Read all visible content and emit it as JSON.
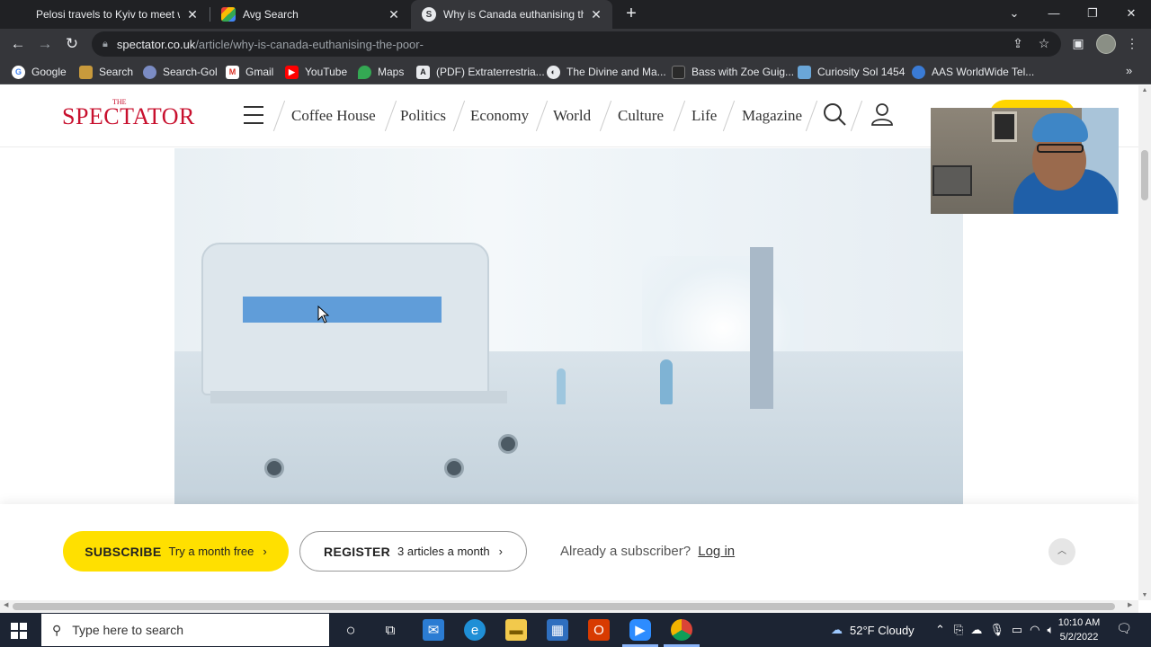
{
  "browser": {
    "tabs": [
      {
        "title": "Pelosi travels to Kyiv to meet with",
        "favicon": "news-icon",
        "active": false
      },
      {
        "title": "Avg Search",
        "favicon": "avg-icon",
        "active": false
      },
      {
        "title": "Why is Canada euthanising the p",
        "favicon": "spectator-icon",
        "active": true
      }
    ],
    "new_tab": "+",
    "url_host": "spectator.co.uk",
    "url_path": "/article/why-is-canada-euthanising-the-poor-",
    "bookmarks": [
      {
        "label": "Google",
        "icon": "google-icon",
        "color": "#4285f4"
      },
      {
        "label": "Search",
        "icon": "bookmark-icon",
        "color": "#c89a3c"
      },
      {
        "label": "Search-Gol",
        "icon": "fingerprint-icon",
        "color": "#7b8cc4"
      },
      {
        "label": "Gmail",
        "icon": "gmail-icon",
        "color": "#d93025"
      },
      {
        "label": "YouTube",
        "icon": "youtube-icon",
        "color": "#ff0000"
      },
      {
        "label": "Maps",
        "icon": "maps-icon",
        "color": "#34a853"
      },
      {
        "label": "(PDF) Extraterrestria...",
        "icon": "pdf-icon",
        "color": "#e8eaed"
      },
      {
        "label": "The Divine and Ma...",
        "icon": "globe-icon",
        "color": "#e8eaed"
      },
      {
        "label": "Bass with Zoe Guig...",
        "icon": "video-icon",
        "color": "#2a2a2a"
      },
      {
        "label": "Curiosity Sol 1454",
        "icon": "image-icon",
        "color": "#6aa6d8"
      },
      {
        "label": "AAS WorldWide Tel...",
        "icon": "planet-icon",
        "color": "#3a7bd5"
      }
    ]
  },
  "site": {
    "logo_the": "THE",
    "logo": "SPECTATOR",
    "nav": [
      "Coffee House",
      "Politics",
      "Economy",
      "World",
      "Culture",
      "Life",
      "Magazine"
    ],
    "accent": "#c8102e"
  },
  "cta": {
    "subscribe_label": "SUBSCRIBE",
    "subscribe_sub": "Try a month free",
    "register_label": "REGISTER",
    "register_sub": "3 articles a month",
    "already": "Already a subscriber?",
    "login": "Log in",
    "subscribe_color": "#ffe000"
  },
  "taskbar": {
    "search_placeholder": "Type here to search",
    "weather": "52°F  Cloudy",
    "time": "10:10 AM",
    "date": "5/2/2022"
  }
}
